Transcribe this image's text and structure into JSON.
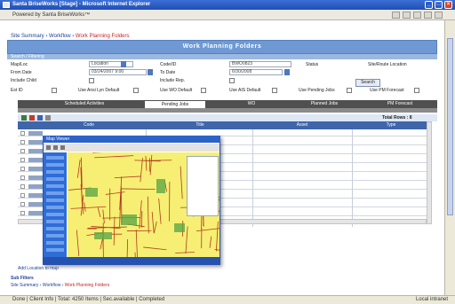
{
  "window": {
    "title": "Santa BriseWorks [Stage] - Microsoft Internet Explorer",
    "address": "Powered by Santa BriseWorks™"
  },
  "breadcrumbs": {
    "prefix": "Site Summary › Workflow ›",
    "current": "Work Planning Folders"
  },
  "page": {
    "title": "Work Planning Folders",
    "filter_link": "Search / Filtering"
  },
  "form": {
    "fields": {
      "row1": {
        "l1": "Map/Loc",
        "v1": "Location",
        "l2": "Code/ID",
        "v2": "BWO0823",
        "l3": "Status",
        "l4": "Site/Route Location"
      },
      "row2": {
        "l1": "From Date",
        "v1": "03/24/2007 9:00",
        "l2": "To Date",
        "v2": "6/30/2008"
      },
      "row3": {
        "l1": "Include Child",
        "l2": "Include Rep."
      },
      "row4": {
        "l1": "Est ID",
        "l2": "Use Ansi Lyn Default",
        "l3": "Use WO Default",
        "l4": "Use AIS Default",
        "l5": "Use Pending Jobs",
        "l6": "Use PM Forecast"
      }
    },
    "search_label": "Search"
  },
  "tabs": [
    {
      "label": "Scheduled Activities",
      "active": false
    },
    {
      "label": "Pending Jobs",
      "active": true
    },
    {
      "label": "WO",
      "active": false
    },
    {
      "label": "Planned Jobs",
      "active": false
    },
    {
      "label": "PM Forecast",
      "active": false
    }
  ],
  "grid": {
    "total_rows_label": "Total Rows : 8",
    "columns": [
      "Code",
      "Title",
      "Asset",
      "Type"
    ],
    "rows": 10
  },
  "popup": {
    "title": "Map Viewer"
  },
  "bottom": {
    "link": "Add Location to map",
    "section": "Sub Filters",
    "crumbs_prefix": "Site Summary › Workflow ›",
    "crumbs_current": "Work Planning Folders"
  },
  "status": {
    "left": "Done | Client Info | Total: 4250 Items | Sec.available | Completed",
    "zone": "Local intranet"
  },
  "colors": {
    "accent": "#6e99d4",
    "header_dark": "#3f65aa",
    "breadcrumb_active": "#cc2222",
    "map_bg": "#f6ef74"
  }
}
